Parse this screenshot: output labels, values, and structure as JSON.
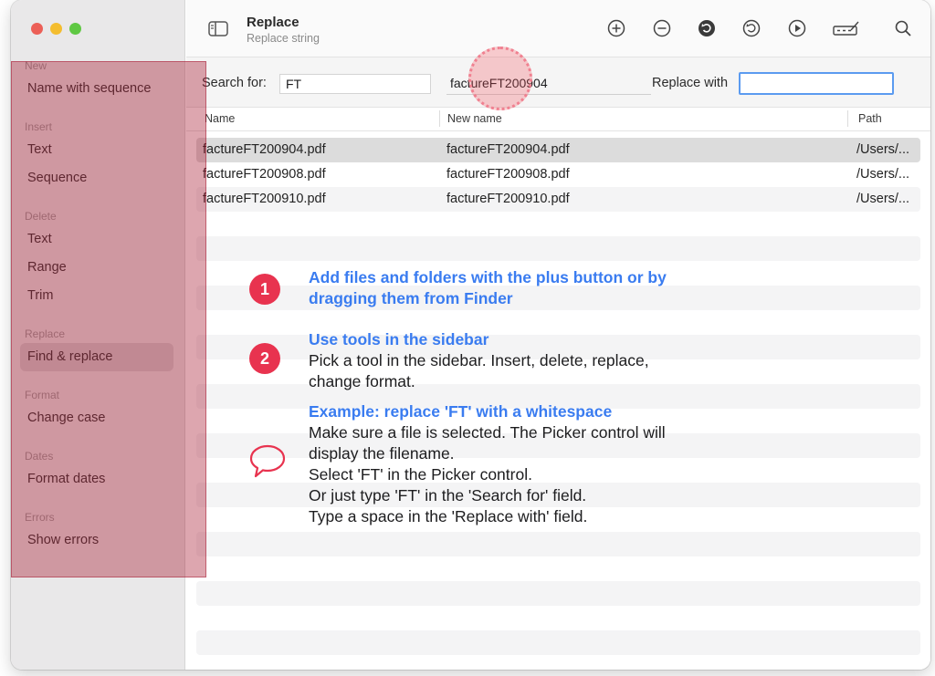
{
  "window": {
    "title": "Replace",
    "subtitle": "Replace string"
  },
  "sidebar": {
    "sections": [
      {
        "title": "New",
        "items": [
          "Name with sequence"
        ]
      },
      {
        "title": "Insert",
        "items": [
          "Text",
          "Sequence"
        ]
      },
      {
        "title": "Delete",
        "items": [
          "Text",
          "Range",
          "Trim"
        ]
      },
      {
        "title": "Replace",
        "items": [
          "Find & replace"
        ]
      },
      {
        "title": "Format",
        "items": [
          "Change case"
        ]
      },
      {
        "title": "Dates",
        "items": [
          "Format dates"
        ]
      },
      {
        "title": "Errors",
        "items": [
          "Show errors"
        ]
      }
    ],
    "selected_item": "Find & replace"
  },
  "toolbar": {
    "icons": [
      "add-icon",
      "remove-icon",
      "undo-filled-icon",
      "undo-icon",
      "play-icon",
      "rename-field-icon",
      "search-icon"
    ]
  },
  "search": {
    "search_label": "Search for:",
    "search_value": "FT",
    "picker_value": "factureFT200904",
    "replace_label": "Replace with",
    "replace_value": ""
  },
  "table": {
    "columns": [
      "Name",
      "New name",
      "Path"
    ],
    "rows": [
      {
        "name": "factureFT200904.pdf",
        "new_name": "factureFT200904.pdf",
        "path": "/Users/..."
      },
      {
        "name": "factureFT200908.pdf",
        "new_name": "factureFT200908.pdf",
        "path": "/Users/..."
      },
      {
        "name": "factureFT200910.pdf",
        "new_name": "factureFT200910.pdf",
        "path": "/Users/..."
      }
    ]
  },
  "help": {
    "step1": {
      "badge": "1",
      "title_line1": "Add files and folders with the plus button or by",
      "title_line2": "dragging them from Finder"
    },
    "step2": {
      "badge": "2",
      "title": "Use tools in the sidebar",
      "text_line1": "Pick a tool in the sidebar. Insert, delete, replace,",
      "text_line2": "change format."
    },
    "example": {
      "title": "Example: replace 'FT' with a whitespace",
      "lines": [
        "Make sure a file is selected. The Picker control will",
        "display the filename.",
        "Select 'FT' in the Picker control.",
        "Or just type 'FT' in the 'Search for' field.",
        "Type a space in the 'Replace with' field."
      ]
    }
  },
  "colors": {
    "accent": "#3a7cf0",
    "badge": "#e8334f",
    "sidebar_overlay": "#a5142d",
    "focus_ring": "#5b9bf0"
  }
}
